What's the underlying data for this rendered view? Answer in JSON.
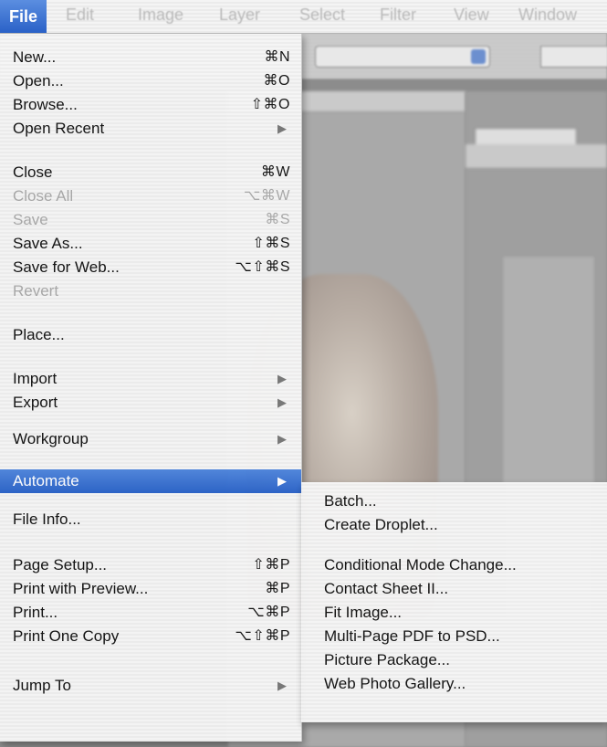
{
  "menubar": {
    "titles": [
      "File",
      "Edit",
      "Image",
      "Layer",
      "Select",
      "Filter",
      "View",
      "Window"
    ]
  },
  "file_menu": {
    "items": [
      {
        "label": "New...",
        "shortcut": "⌘N",
        "enabled": true
      },
      {
        "label": "Open...",
        "shortcut": "⌘O",
        "enabled": true
      },
      {
        "label": "Browse...",
        "shortcut": "⇧⌘O",
        "enabled": true
      },
      {
        "label": "Open Recent",
        "submenu": true,
        "enabled": true
      },
      {
        "label": "Close",
        "shortcut": "⌘W",
        "enabled": true
      },
      {
        "label": "Close All",
        "shortcut": "⌥⌘W",
        "enabled": false
      },
      {
        "label": "Save",
        "shortcut": "⌘S",
        "enabled": false
      },
      {
        "label": "Save As...",
        "shortcut": "⇧⌘S",
        "enabled": true
      },
      {
        "label": "Save for Web...",
        "shortcut": "⌥⇧⌘S",
        "enabled": true
      },
      {
        "label": "Revert",
        "enabled": false
      },
      {
        "label": "Place...",
        "enabled": true
      },
      {
        "label": "Import",
        "submenu": true,
        "enabled": true
      },
      {
        "label": "Export",
        "submenu": true,
        "enabled": true
      },
      {
        "label": "Workgroup",
        "submenu": true,
        "enabled": true
      },
      {
        "label": "Automate",
        "submenu": true,
        "enabled": true,
        "selected": true
      },
      {
        "label": "File Info...",
        "enabled": true
      },
      {
        "label": "Page Setup...",
        "shortcut": "⇧⌘P",
        "enabled": true
      },
      {
        "label": "Print with Preview...",
        "shortcut": "⌘P",
        "enabled": true
      },
      {
        "label": "Print...",
        "shortcut": "⌥⌘P",
        "enabled": true
      },
      {
        "label": "Print One Copy",
        "shortcut": "⌥⇧⌘P",
        "enabled": true
      },
      {
        "label": "Jump To",
        "submenu": true,
        "enabled": true
      }
    ]
  },
  "automate_submenu": {
    "items": [
      {
        "label": "Batch..."
      },
      {
        "label": "Create Droplet..."
      },
      {
        "label": "Conditional Mode Change..."
      },
      {
        "label": "Contact Sheet II..."
      },
      {
        "label": "Fit Image..."
      },
      {
        "label": "Multi-Page PDF to PSD..."
      },
      {
        "label": "Picture Package..."
      },
      {
        "label": "Web Photo Gallery..."
      }
    ]
  },
  "colors": {
    "selection": "#2b63c8",
    "disabled_text": "#a8a8a8"
  }
}
